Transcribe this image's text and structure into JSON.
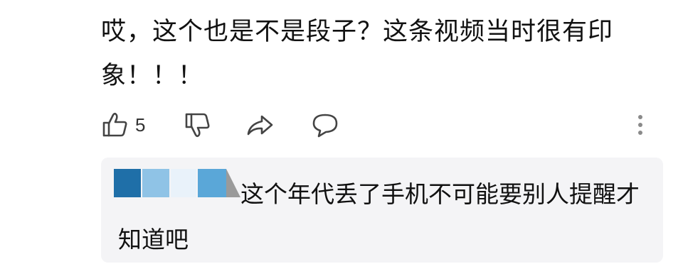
{
  "comment": {
    "text": "哎，这个也是不是段子？这条视频当时很有印象！！！"
  },
  "actions": {
    "like_count": "5",
    "icons": {
      "like": "thumbs-up-icon",
      "dislike": "thumbs-down-icon",
      "share": "share-arrow-icon",
      "reply": "speech-bubble-icon",
      "more": "vertical-dots-icon"
    }
  },
  "reply": {
    "text": "这个年代丢了手机不可能要别人提醒才知道吧"
  },
  "colors": {
    "reply_background": "#f4f4f6",
    "icon_stroke": "#444444",
    "avatar_blue_dark": "#1f6fa8",
    "avatar_blue_light": "#8fc3e6",
    "avatar_blue_pale": "#e9f2fa",
    "avatar_blue_mid": "#5aa7d8",
    "avatar_gray": "#9a9a9a"
  }
}
